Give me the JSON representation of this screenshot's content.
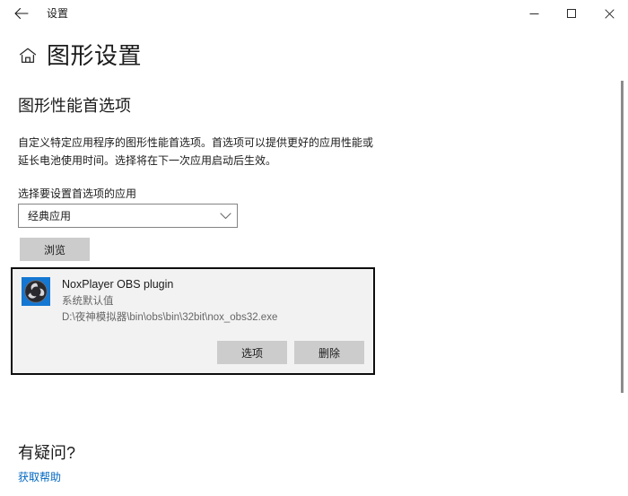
{
  "window": {
    "titlebar_title": "设置",
    "back_icon": "back-arrow-icon",
    "minimize_label": "—",
    "maximize_label": "□",
    "close_label": "✕"
  },
  "header": {
    "home_icon": "home-icon",
    "page_title": "图形设置"
  },
  "main": {
    "section_heading": "图形性能首选项",
    "description": "自定义特定应用程序的图形性能首选项。首选项可以提供更好的应用性能或延长电池使用时间。选择将在下一次应用启动后生效。",
    "field_label": "选择要设置首选项的应用",
    "combobox": {
      "selected": "经典应用",
      "chevron_icon": "chevron-down-icon",
      "options": [
        "经典应用"
      ]
    },
    "browse_button": "浏览"
  },
  "app_card": {
    "icon": "obs-plugin-icon",
    "name": "NoxPlayer OBS plugin",
    "subtitle": "系统默认值",
    "path": "D:\\夜神模拟器\\bin\\obs\\bin\\32bit\\nox_obs32.exe",
    "options_button": "选项",
    "remove_button": "删除"
  },
  "help": {
    "heading": "有疑问?",
    "link_text": "获取帮助"
  },
  "colors": {
    "accent_link": "#0067c0",
    "icon_background": "#1477d2",
    "button_background": "#cccccc",
    "card_background": "#f2f2f2",
    "card_border": "#0d0d0d"
  }
}
